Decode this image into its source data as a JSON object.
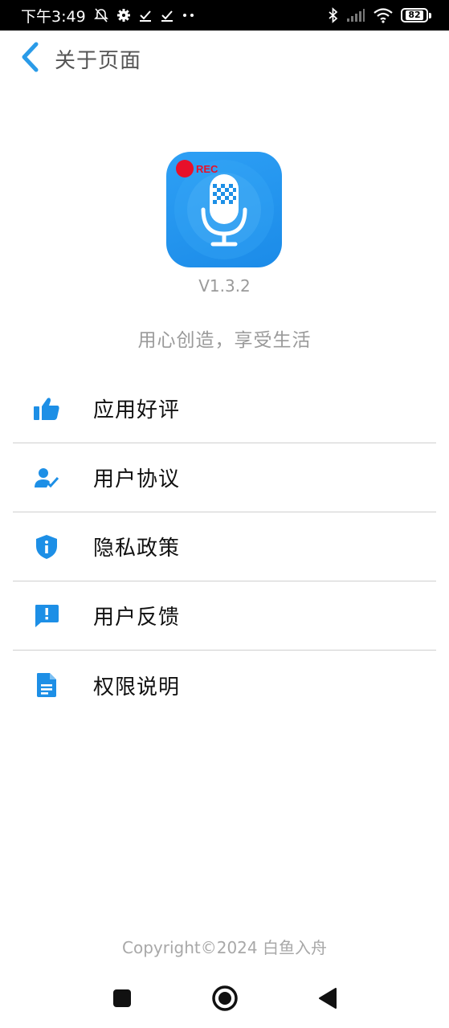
{
  "status_bar": {
    "time": "下午3:49",
    "battery_level": "82",
    "icons": [
      "alarm-off-icon",
      "gear-icon",
      "check-icon",
      "check-icon",
      "dots-icon",
      "bluetooth-icon",
      "signal-icon",
      "wifi-icon",
      "battery-icon"
    ]
  },
  "header": {
    "title": "关于页面",
    "back_icon": "chevron-left-icon"
  },
  "app": {
    "icon_name": "microphone-rec-icon",
    "rec_label": "REC",
    "version": "V1.3.2",
    "slogan": "用心创造，享受生活"
  },
  "menu": {
    "items": [
      {
        "label": "应用好评",
        "icon": "thumbs-up-icon"
      },
      {
        "label": "用户协议",
        "icon": "user-check-icon"
      },
      {
        "label": "隐私政策",
        "icon": "shield-info-icon"
      },
      {
        "label": "用户反馈",
        "icon": "feedback-icon"
      },
      {
        "label": "权限说明",
        "icon": "document-icon"
      }
    ]
  },
  "footer": {
    "copyright": "Copyright©2024 白鱼入舟"
  },
  "nav_bar": {
    "icons": [
      "square-recents-icon",
      "circle-home-icon",
      "triangle-back-icon"
    ]
  },
  "colors": {
    "accent": "#1d8fe6",
    "status_bar_bg": "#000000",
    "rec_red": "#e8102a"
  }
}
